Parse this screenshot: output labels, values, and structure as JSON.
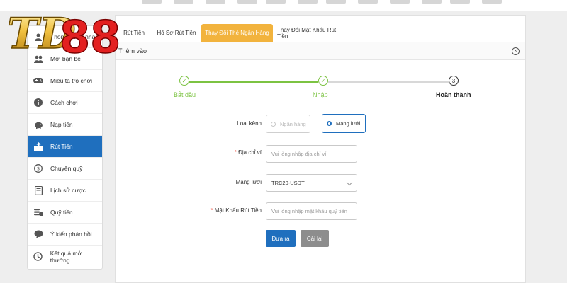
{
  "logo": {
    "text": "TD88"
  },
  "sidebar": {
    "items": [
      {
        "label": "Thông tin cá nhân",
        "icon": "user-icon"
      },
      {
        "label": "Mời bạn bè",
        "icon": "invite-icon"
      },
      {
        "label": "Miêu tả trò chơi",
        "icon": "gamepad-icon"
      },
      {
        "label": "Cách chơi",
        "icon": "info-icon"
      },
      {
        "label": "Nạp tiền",
        "icon": "piggy-bank-icon"
      },
      {
        "label": "Rút Tiền",
        "icon": "withdraw-icon"
      },
      {
        "label": "Chuyển quỹ",
        "icon": "transfer-icon"
      },
      {
        "label": "Lịch sử cược",
        "icon": "history-doc-icon"
      },
      {
        "label": "Quỹ tiền",
        "icon": "coins-icon"
      },
      {
        "label": "Ý kiến phản hồi",
        "icon": "feedback-icon"
      },
      {
        "label": "Kết quả mở thưởng",
        "icon": "clock-icon"
      }
    ]
  },
  "tabs": [
    {
      "label": "Rút Tiền"
    },
    {
      "label": "Hồ Sơ Rút Tiền"
    },
    {
      "label": "Thay Đổi Thẻ Ngân Hàng"
    },
    {
      "label": "Thay Đổi Mật Khẩu Rút Tiền"
    }
  ],
  "subbar": {
    "title": "Thêm vào",
    "close": "×"
  },
  "stepper": {
    "steps": [
      {
        "num": "✓",
        "label": "Bắt đầu"
      },
      {
        "num": "✓",
        "label": "Nhập"
      },
      {
        "num": "3",
        "label": "Hoàn thành"
      }
    ]
  },
  "form": {
    "channel": {
      "label": "Loại kênh",
      "options": [
        "Ngân hàng",
        "Mạng lưới"
      ]
    },
    "address": {
      "req": "*",
      "label": "Địa chỉ ví",
      "placeholder": "Vui lòng nhập địa chỉ ví"
    },
    "network": {
      "label": "Mạng lưới",
      "value": "TRC20-USDT"
    },
    "password": {
      "req": "*",
      "label": "Mật Khẩu Rút Tiền",
      "placeholder": "Vui lòng nhập mật khẩu quỹ tiền"
    },
    "submit": "Đưa ra",
    "reset": "Cài lại"
  },
  "colors": {
    "accent": "#1f6fbe",
    "tab_active": "#f2b33d",
    "step_done": "#7cc342"
  }
}
